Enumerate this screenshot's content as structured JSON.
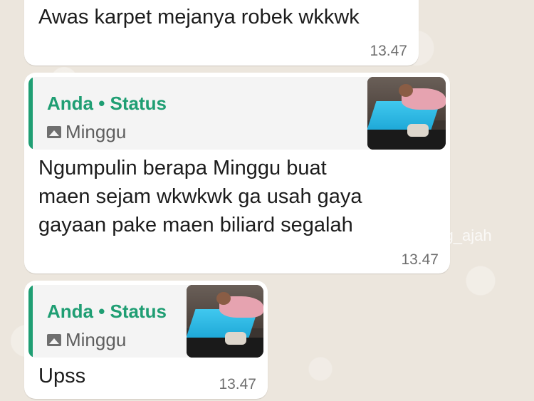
{
  "messages": [
    {
      "text": "Awas karpet mejanya robek wkkwk",
      "time": "13.47"
    },
    {
      "quote": {
        "author": "Anda • Status",
        "label": "Minggu",
        "label_icon": "photo-icon"
      },
      "lines": [
        "Ngumpulin berapa Minggu buat",
        "maen sejam  wkwkwk ga usah gaya",
        "gayaan pake maen biliard segalah"
      ],
      "time": "13.47"
    },
    {
      "quote": {
        "author": "Anda • Status",
        "label": "Minggu",
        "label_icon": "photo-icon"
      },
      "text": "Upss",
      "time": "13.47"
    }
  ],
  "watermark": "@  tg_ajah",
  "colors": {
    "accent": "#1f9e73",
    "bubble": "#ffffff",
    "background": "#ece6dd",
    "time": "#6f6f6f"
  }
}
